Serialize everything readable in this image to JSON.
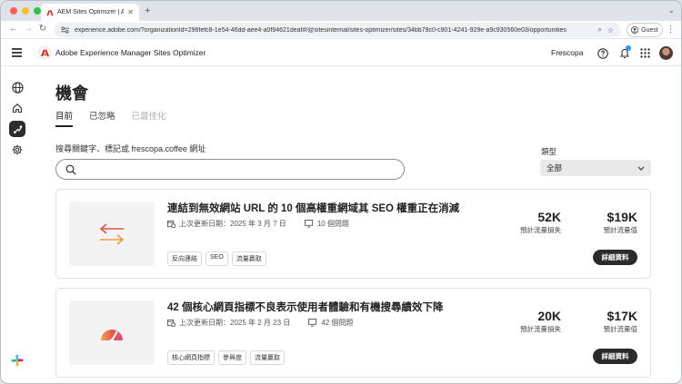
{
  "browser": {
    "tab_title": "AEM Sites Optimizer | Adobe",
    "url": "experience.adobe.com/?organizationId=296fefc8-1e54-46dd-aee4-a0f94621deaf#/@sitesinternal/sites-optimizer/sites/34bb79c0-c901-4241-929e-a9c930560e03/opportunities",
    "profile_label": "Guest"
  },
  "header": {
    "app_title": "Adobe Experience Manager Sites Optimizer",
    "org_name": "Frescopa"
  },
  "page": {
    "title": "機會",
    "tabs": [
      {
        "label": "目前",
        "state": "selected"
      },
      {
        "label": "已忽略",
        "state": "normal"
      },
      {
        "label": "已最佳化",
        "state": "disabled"
      }
    ],
    "search_label": "搜尋關鍵字、標記或 frescopa.coffee 網址",
    "search_value": "",
    "type_label": "類型",
    "type_selected": "全部"
  },
  "cards": [
    {
      "icon": "redirect-arrows-icon",
      "title": "連結到無效網站 URL 的 10 個高權重網域其 SEO 權重正在消減",
      "updated": "上次更新日期：2025 年 3 月 7 日",
      "issues": "10 個問題",
      "tags": [
        "反向連結",
        "SEO",
        "流量贏取"
      ],
      "traffic_loss_value": "52K",
      "traffic_loss_label": "預計流量損失",
      "traffic_value_value": "$19K",
      "traffic_value_label": "預計流量值",
      "button_label": "詳細資料"
    },
    {
      "icon": "speed-gauge-icon",
      "title": "42 個核心網頁指標不良表示使用者體驗和有機搜尋績效下降",
      "updated": "上次更新日期：2025 年 2 月 23 日",
      "issues": "42 個問題",
      "tags": [
        "核心網頁指標",
        "參與度",
        "流量贏取"
      ],
      "traffic_loss_value": "20K",
      "traffic_loss_label": "預計流量損失",
      "traffic_value_value": "$17K",
      "traffic_value_label": "預計流量值",
      "button_label": "詳細資料"
    }
  ],
  "colors": {
    "adobe_red": "#eb1000",
    "accent_dark": "#2b2b2b",
    "notification_blue": "#3a8dff"
  }
}
